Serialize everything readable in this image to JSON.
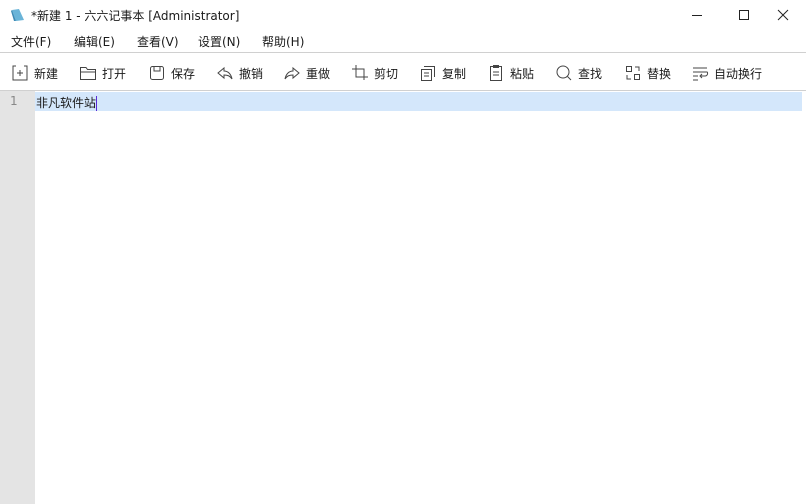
{
  "window": {
    "title": "*新建 1 - 六六记事本 [Administrator]"
  },
  "menu": [
    "文件(F)",
    "编辑(E)",
    "查看(V)",
    "设置(N)",
    "帮助(H)"
  ],
  "toolbar": [
    {
      "icon": "new-icon",
      "label": "新建"
    },
    {
      "icon": "open-folder-icon",
      "label": "打开"
    },
    {
      "icon": "save-icon",
      "label": "保存"
    },
    {
      "icon": "undo-icon",
      "label": "撤销"
    },
    {
      "icon": "redo-icon",
      "label": "重做"
    },
    {
      "icon": "cut-icon",
      "label": "剪切"
    },
    {
      "icon": "copy-icon",
      "label": "复制"
    },
    {
      "icon": "paste-icon",
      "label": "粘贴"
    },
    {
      "icon": "search-icon",
      "label": "查找"
    },
    {
      "icon": "replace-icon",
      "label": "替换"
    },
    {
      "icon": "word-wrap-icon",
      "label": "自动换行"
    }
  ],
  "editor": {
    "line_numbers": [
      "1"
    ],
    "lines": [
      "非凡软件站"
    ]
  },
  "colors": {
    "current_line": "#d4e7fb",
    "gutter": "#e4e4e4",
    "caret": "#5a2bd6"
  }
}
